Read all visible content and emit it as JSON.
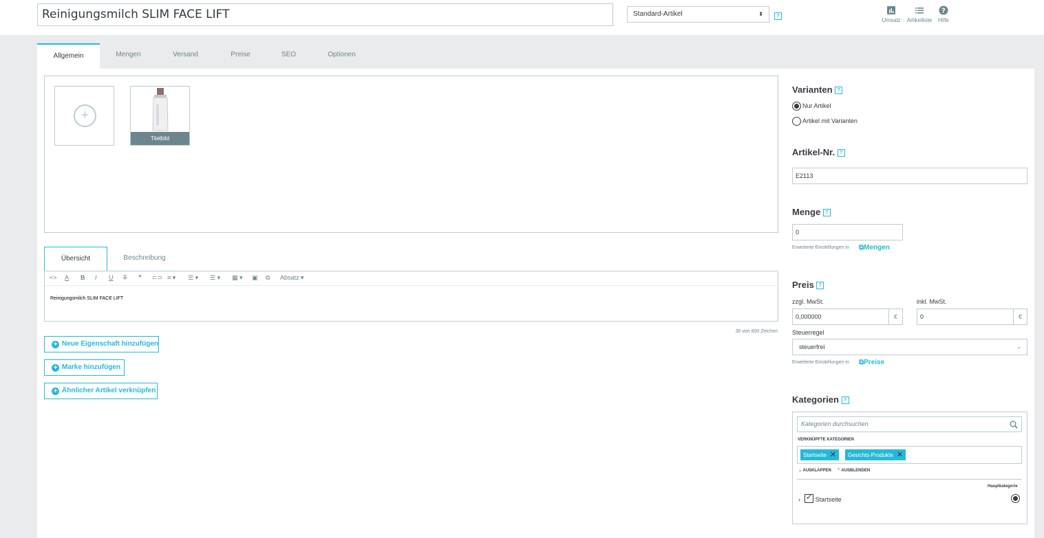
{
  "header": {
    "product_name": "Reinigungsmilch SLIM FACE LIFT",
    "product_type": "Standard-Artikel",
    "help_label": "?",
    "tools": [
      {
        "icon": "chart-icon",
        "label": "Umsatz"
      },
      {
        "icon": "list-icon",
        "label": "Artikelliste"
      },
      {
        "icon": "help-circle-icon",
        "label": "Hilfe"
      }
    ]
  },
  "tabs": [
    "Allgemein",
    "Mengen",
    "Versand",
    "Preise",
    "SEO",
    "Optionen"
  ],
  "active_tab": "Allgemein",
  "images": {
    "cover_label": "Titelbild"
  },
  "editor": {
    "tabs": [
      "Übersicht",
      "Beschreibung"
    ],
    "active_tab": "Übersicht",
    "paragraph_label": "Absatz",
    "content": "Reinigungsmilch SLIM FACE LIFT",
    "char_count": "30 von 800 Zeichen"
  },
  "buttons": {
    "add_feature": "Neue Eigenschaft hinzufügen",
    "add_brand": "Marke hinzufügen",
    "link_related": "Ähnlicher Artikel verknüpfen"
  },
  "variants": {
    "heading": "Varianten",
    "options": [
      "Nur Artikel",
      "Artikel mit Varianten"
    ],
    "selected": "Nur Artikel"
  },
  "reference": {
    "heading": "Artikel-Nr.",
    "value": "E2113"
  },
  "quantity": {
    "heading": "Menge",
    "value": "0",
    "advanced_text": "Erweiterte Einstellungen in",
    "advanced_link": "Mengen"
  },
  "price": {
    "heading": "Preis",
    "excl_label": "zzgl. MwSt.",
    "excl_value": "0,000000",
    "incl_label": "inkl. MwSt.",
    "incl_value": "0",
    "currency": "€",
    "tax_rule_label": "Steuerregel",
    "tax_rule_value": "steuerfrei",
    "advanced_text": "Erweiterte Einstellungen in",
    "advanced_link": "Preise"
  },
  "categories": {
    "heading": "Kategorien",
    "search_placeholder": "Kategorien durchsuchen",
    "linked_label": "VERKNÜPFTE KATEGORIEN",
    "tags": [
      "Startseite",
      "Gesichts-Produkte"
    ],
    "expand_label": "AUSKLAPPEN",
    "collapse_label": "AUSBLENDEN",
    "main_category_label": "Hauptkategorie",
    "tree": [
      {
        "label": "Startseite",
        "checked": true,
        "main": true
      }
    ]
  }
}
